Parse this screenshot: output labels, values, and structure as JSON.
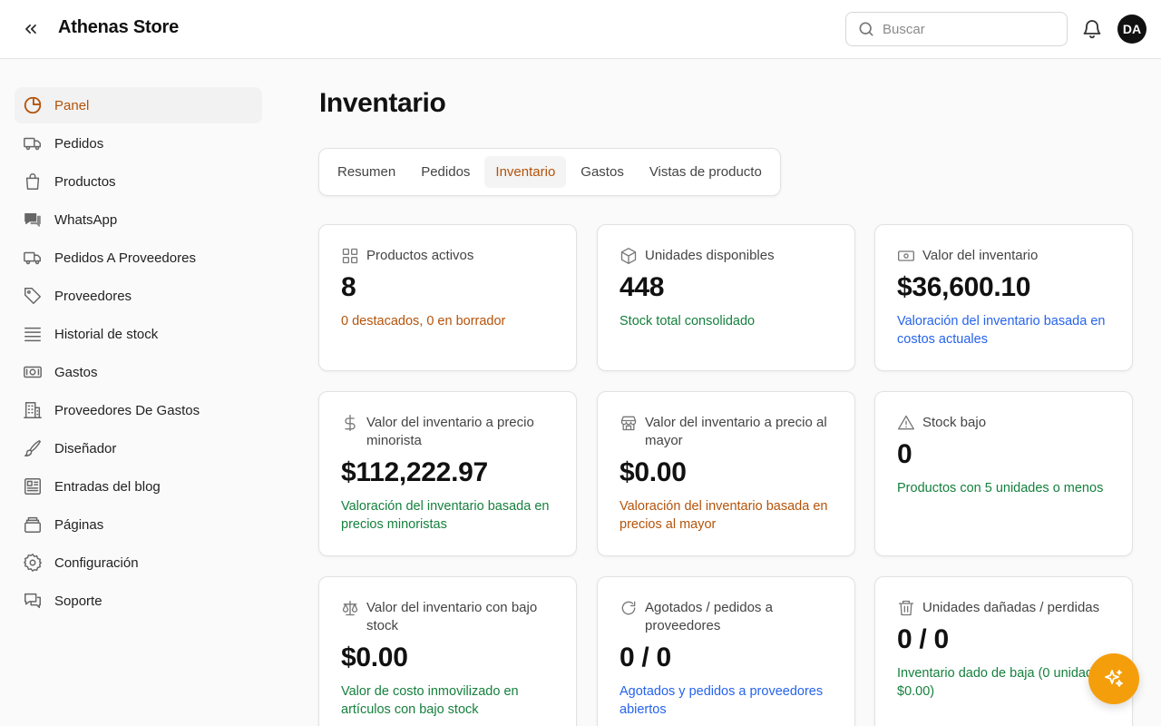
{
  "header": {
    "store_name": "Athenas Store",
    "search_placeholder": "Buscar",
    "avatar_initials": "DA"
  },
  "sidebar": {
    "items": [
      {
        "label": "Panel",
        "icon": "pie-chart-icon",
        "active": true
      },
      {
        "label": "Pedidos",
        "icon": "truck-icon"
      },
      {
        "label": "Productos",
        "icon": "shopping-bag-icon"
      },
      {
        "label": "WhatsApp",
        "icon": "chat-bubbles-icon"
      },
      {
        "label": "Pedidos A Proveedores",
        "icon": "truck-icon"
      },
      {
        "label": "Proveedores",
        "icon": "tag-icon"
      },
      {
        "label": "Historial de stock",
        "icon": "stack-lines-icon"
      },
      {
        "label": "Gastos",
        "icon": "banknote-icon"
      },
      {
        "label": "Proveedores De Gastos",
        "icon": "building-icon"
      },
      {
        "label": "Diseñador",
        "icon": "paintbrush-icon"
      },
      {
        "label": "Entradas del blog",
        "icon": "newspaper-icon"
      },
      {
        "label": "Páginas",
        "icon": "layers-icon"
      },
      {
        "label": "Configuración",
        "icon": "gear-icon"
      },
      {
        "label": "Soporte",
        "icon": "support-chat-icon"
      }
    ]
  },
  "main": {
    "title": "Inventario",
    "tabs": [
      {
        "label": "Resumen"
      },
      {
        "label": "Pedidos"
      },
      {
        "label": "Inventario",
        "active": true
      },
      {
        "label": "Gastos"
      },
      {
        "label": "Vistas de producto"
      }
    ],
    "cards": [
      {
        "label": "Productos activos",
        "value": "8",
        "desc": "0 destacados, 0 en borrador",
        "icon": "grid-icon",
        "tone": "orange"
      },
      {
        "label": "Unidades disponibles",
        "value": "448",
        "desc": "Stock total consolidado",
        "icon": "box-icon",
        "tone": "green"
      },
      {
        "label": "Valor del inventario",
        "value": "$36,600.10",
        "desc": "Valoración del inventario basada en costos actuales",
        "icon": "cash-icon",
        "tone": "blue"
      },
      {
        "label": "Valor del inventario a precio minorista",
        "value": "$112,222.97",
        "desc": "Valoración del inventario basada en precios minoristas",
        "icon": "dollar-icon",
        "tone": "green"
      },
      {
        "label": "Valor del inventario a precio al mayor",
        "value": "$0.00",
        "desc": "Valoración del inventario basada en precios al mayor",
        "icon": "store-icon",
        "tone": "orange"
      },
      {
        "label": "Stock bajo",
        "value": "0",
        "desc": "Productos con 5 unidades o menos",
        "icon": "warning-icon",
        "tone": "green"
      },
      {
        "label": "Valor del inventario con bajo stock",
        "value": "$0.00",
        "desc": "Valor de costo inmovilizado en artículos con bajo stock",
        "icon": "scale-icon",
        "tone": "green"
      },
      {
        "label": "Agotados / pedidos a proveedores",
        "value": "0 / 0",
        "desc": "Agotados y pedidos a proveedores abiertos",
        "icon": "refresh-icon",
        "tone": "blue"
      },
      {
        "label": "Unidades dañadas / perdidas",
        "value": "0 / 0",
        "desc": "Inventario dado de baja (0 unidades, $0.00)",
        "icon": "trash-icon",
        "tone": "green"
      }
    ]
  },
  "colors": {
    "accent": "#b4530a",
    "positive": "#15803d",
    "info": "#2563eb",
    "fab": "#f59e0b"
  },
  "fab": {
    "icon": "sparkles-icon"
  }
}
